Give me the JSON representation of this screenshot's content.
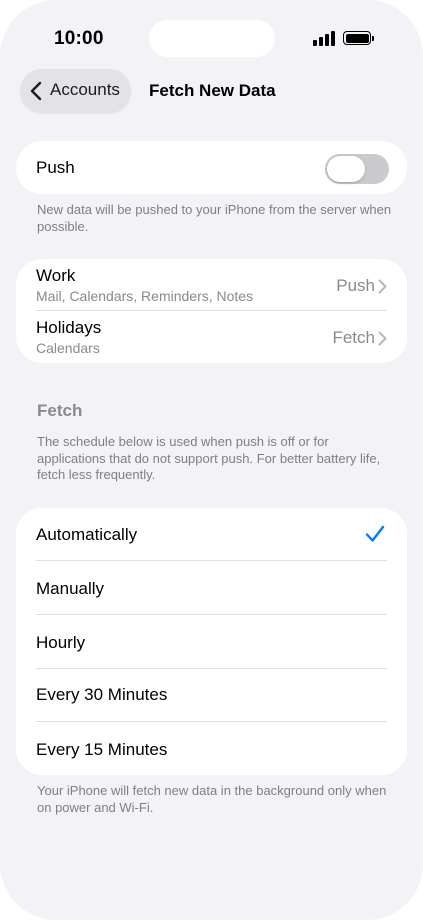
{
  "status_bar": {
    "time": "10:00",
    "icons": [
      "cellular-signal-icon",
      "battery-icon"
    ]
  },
  "nav": {
    "back_label": "Accounts",
    "title": "Fetch New Data"
  },
  "push": {
    "label": "Push",
    "enabled": false,
    "footnote": "New data will be pushed to your iPhone from the server when possible."
  },
  "accounts": [
    {
      "name": "Work",
      "detail": "Mail, Calendars, Reminders, Notes",
      "value": "Push"
    },
    {
      "name": "Holidays",
      "detail": "Calendars",
      "value": "Fetch"
    }
  ],
  "fetch": {
    "header": "Fetch",
    "description": "The schedule below is used when push is off or for applications that do not support push. For better battery life, fetch less frequently.",
    "options": [
      "Automatically",
      "Manually",
      "Hourly",
      "Every 30 Minutes",
      "Every 15 Minutes"
    ],
    "selected": "Automatically",
    "footnote": "Your iPhone will fetch new data in the background only when on power and Wi-Fi."
  },
  "colors": {
    "accent": "#007aff",
    "background": "#f2f2f7",
    "secondary_text": "#8a8a8e"
  }
}
